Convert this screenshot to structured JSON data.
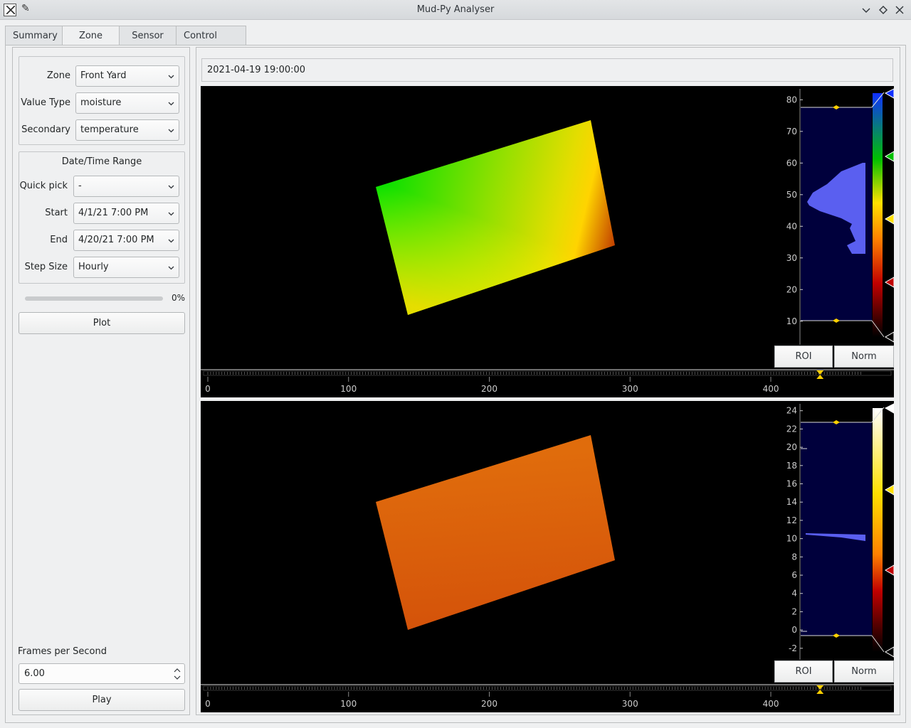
{
  "window": {
    "title": "Mud-Py Analyser"
  },
  "tabs": [
    "Summary",
    "Zone",
    "Sensor",
    "Control Node"
  ],
  "controls": {
    "zone_label": "Zone",
    "zone_value": "Front Yard",
    "value_type_label": "Value Type",
    "value_type_value": "moisture",
    "secondary_label": "Secondary",
    "secondary_value": "temperature",
    "range_title": "Date/Time Range",
    "quick_pick_label": "Quick pick",
    "quick_pick_value": "-",
    "start_label": "Start",
    "start_value": "4/1/21 7:00 PM",
    "end_label": "End",
    "end_value": "4/20/21 7:00 PM",
    "step_label": "Step Size",
    "step_value": "Hourly",
    "progress_percent": 0,
    "progress_text": "0%",
    "plot_label": "Plot",
    "fps_label": "Frames per Second",
    "fps_value": "6.00",
    "play_label": "Play"
  },
  "viewer": {
    "timestamp": "2021-04-19 19:00:00",
    "time_axis_ticks": [
      "0",
      "100",
      "200",
      "300",
      "400"
    ],
    "time_axis_max": 465,
    "current_frame": 435,
    "roi_label": "ROI",
    "norm_label": "Norm",
    "primary": {
      "levels_ticks": [
        "80",
        "70",
        "60",
        "50",
        "40",
        "30",
        "20",
        "10"
      ],
      "levels_range": [
        5,
        83
      ],
      "level_min": 10.2,
      "level_max": 77
    },
    "secondary": {
      "levels_ticks": [
        "24",
        "22",
        "20",
        "18",
        "16",
        "14",
        "12",
        "10",
        "8",
        "6",
        "4",
        "2",
        "0",
        "-2"
      ],
      "levels_range": [
        -2.4,
        24.6
      ],
      "level_min": -0.5,
      "level_max": 22.5
    }
  },
  "colors": {
    "accent": "#ffff00",
    "histogram": "#5a5ff0",
    "histogram_bg": "#00003c"
  }
}
